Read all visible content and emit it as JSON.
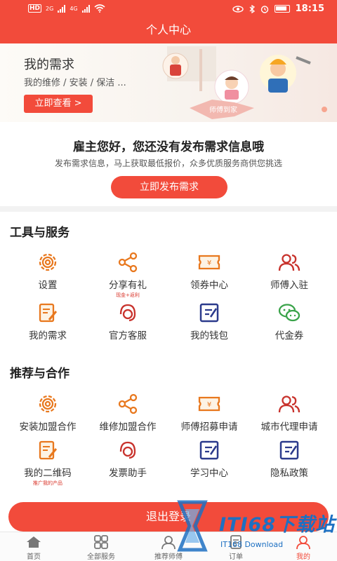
{
  "status_bar": {
    "network_label": "HD",
    "sig1": "2G",
    "sig2": "4G",
    "time": "18:15"
  },
  "header": {
    "title": "个人中心"
  },
  "banner": {
    "title": "我的需求",
    "subtitle": "我的维修 / 安装 / 保洁 ...",
    "button": "立即查看 >",
    "ribbon": "师傅到家"
  },
  "empty_state": {
    "heading": "雇主您好，您还没有发布需求信息哦",
    "description": "发布需求信息，马上获取最低报价，众多优质服务商供您挑选",
    "button": "立即发布需求"
  },
  "tools": {
    "title": "工具与服务",
    "items": [
      {
        "label": "设置",
        "icon": "gear-icon"
      },
      {
        "label": "分享有礼",
        "tag": "现金+返利",
        "icon": "share-icon"
      },
      {
        "label": "领券中心",
        "icon": "coupon-icon"
      },
      {
        "label": "师傅入驻",
        "icon": "users-icon"
      },
      {
        "label": "我的需求",
        "icon": "edit-icon"
      },
      {
        "label": "官方客服",
        "icon": "headset-icon"
      },
      {
        "label": "我的钱包",
        "icon": "wallet-icon"
      },
      {
        "label": "代金券",
        "icon": "wechat-icon"
      }
    ]
  },
  "partners": {
    "title": "推荐与合作",
    "items": [
      {
        "label": "安装加盟合作",
        "icon": "gear-icon"
      },
      {
        "label": "维修加盟合作",
        "icon": "share-icon"
      },
      {
        "label": "师傅招募申请",
        "icon": "coupon-icon"
      },
      {
        "label": "城市代理申请",
        "icon": "users-icon"
      },
      {
        "label": "我的二维码",
        "tag": "推广我的产品",
        "icon": "edit-icon"
      },
      {
        "label": "发票助手",
        "icon": "headset-icon"
      },
      {
        "label": "学习中心",
        "icon": "wallet-icon"
      },
      {
        "label": "隐私政策",
        "icon": "wallet-icon"
      }
    ]
  },
  "logout": {
    "label": "退出登录"
  },
  "tabbar": [
    {
      "label": "首页",
      "icon": "home-icon"
    },
    {
      "label": "全部服务",
      "icon": "grid-icon"
    },
    {
      "label": "推荐师傅",
      "icon": "worker-icon"
    },
    {
      "label": "订单",
      "icon": "order-icon"
    },
    {
      "label": "我的",
      "icon": "profile-icon",
      "active": true
    }
  ],
  "watermark": {
    "text": "ITI68下载站",
    "sub": "IT168 Download"
  },
  "colors": {
    "accent": "#f24b3b",
    "icon_orange": "#e8781e",
    "icon_navy": "#2b3a8c",
    "icon_red": "#c8322c",
    "icon_green": "#3aa34a"
  }
}
